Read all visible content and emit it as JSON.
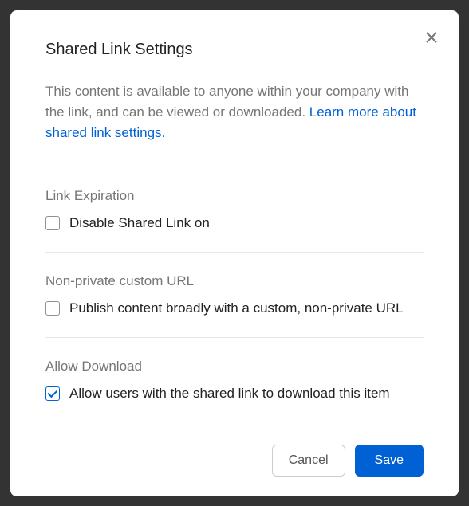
{
  "modal": {
    "title": "Shared Link Settings",
    "description": "This content is available to anyone within your company with the link, and can be viewed or downloaded. ",
    "learn_more": "Learn more about shared link settings."
  },
  "sections": {
    "link_expiration": {
      "title": "Link Expiration",
      "checkbox_label": "Disable Shared Link on",
      "checked": false
    },
    "custom_url": {
      "title": "Non-private custom URL",
      "checkbox_label": "Publish content broadly with a custom, non-private URL",
      "checked": false
    },
    "allow_download": {
      "title": "Allow Download",
      "checkbox_label": "Allow users with the shared link to download this item",
      "checked": true
    }
  },
  "buttons": {
    "cancel": "Cancel",
    "save": "Save"
  }
}
